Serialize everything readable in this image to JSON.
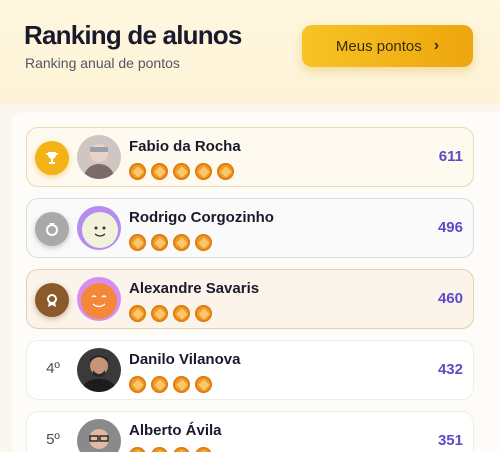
{
  "header": {
    "title": "Ranking de alunos",
    "subtitle": "Ranking anual de pontos",
    "button_label": "Meus pontos",
    "button_icon": "chevron-right-icon"
  },
  "colors": {
    "accent": "#f3b216",
    "points": "#5b4bc4",
    "gold": "#f3b216",
    "silver": "#a9a9a9",
    "bronze": "#8b5a2b"
  },
  "students": [
    {
      "rank": "",
      "medal": "trophy-icon",
      "name": "Fabio da Rocha",
      "badges": 5,
      "points": "611"
    },
    {
      "rank": "",
      "medal": "silver-medal-icon",
      "name": "Rodrigo Corgozinho",
      "badges": 4,
      "points": "496"
    },
    {
      "rank": "",
      "medal": "bronze-medal-icon",
      "name": "Alexandre Savaris",
      "badges": 4,
      "points": "460"
    },
    {
      "rank": "4º",
      "medal": "",
      "name": "Danilo Vilanova",
      "badges": 4,
      "points": "432"
    },
    {
      "rank": "5º",
      "medal": "",
      "name": "Alberto Ávila",
      "badges": 4,
      "points": "351"
    }
  ]
}
